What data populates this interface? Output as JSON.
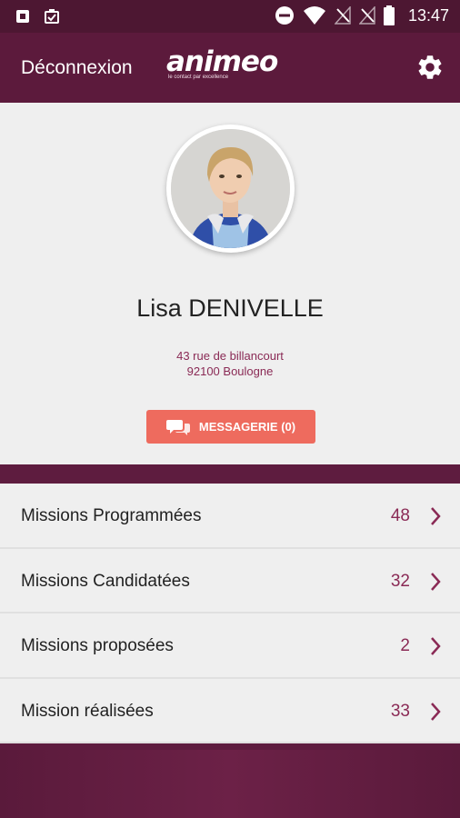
{
  "status_bar": {
    "time": "13:47",
    "left_icons": [
      "notification-app-icon",
      "clipboard-check-icon"
    ],
    "right_icons": [
      "do-not-disturb-icon",
      "wifi-icon",
      "no-signal-icon",
      "no-signal-icon",
      "battery-icon"
    ]
  },
  "header": {
    "logout_label": "Déconnexion",
    "brand_name": "animeo",
    "brand_tagline": "le contact par excellence",
    "settings_icon": "gear-icon"
  },
  "profile": {
    "name": "Lisa DENIVELLE",
    "address_line1": "43 rue de billancourt",
    "address_line2": "92100 Boulogne",
    "message_button_label": "MESSAGERIE (0)",
    "message_icon": "chat-bubbles-icon"
  },
  "missions": [
    {
      "label": "Missions Programmées",
      "count": "48"
    },
    {
      "label": "Missions Candidatées",
      "count": "32"
    },
    {
      "label": "Missions proposées",
      "count": "2"
    },
    {
      "label": "Mission réalisées",
      "count": "33"
    }
  ],
  "colors": {
    "primary": "#5c1a3c",
    "accent_button": "#ee6b5e",
    "count_text": "#8a2a55",
    "background": "#efefef"
  }
}
